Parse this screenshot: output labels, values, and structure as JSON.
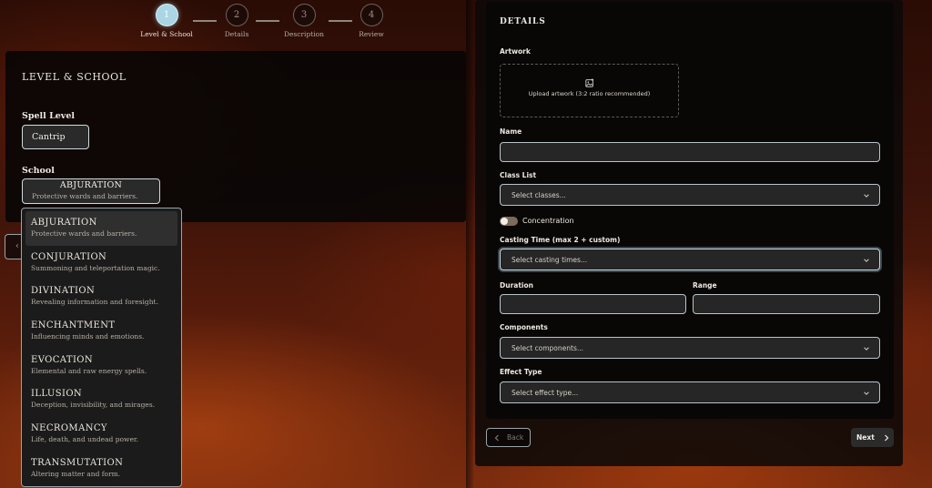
{
  "stepper": {
    "steps": [
      {
        "number": "1",
        "label": "Level & School",
        "active": true
      },
      {
        "number": "2",
        "label": "Details",
        "active": false
      },
      {
        "number": "3",
        "label": "Description",
        "active": false
      },
      {
        "number": "4",
        "label": "Review",
        "active": false
      }
    ]
  },
  "left_panel": {
    "title": "LEVEL & SCHOOL",
    "spell_level_label": "Spell Level",
    "spell_level_value": "Cantrip",
    "school_label": "School",
    "school_selected": {
      "name": "ABJURATION",
      "description": "Protective wards and barriers."
    },
    "school_options": [
      {
        "name": "ABJURATION",
        "description": "Protective wards and barriers."
      },
      {
        "name": "CONJURATION",
        "description": "Summoning and teleportation magic."
      },
      {
        "name": "DIVINATION",
        "description": "Revealing information and foresight."
      },
      {
        "name": "ENCHANTMENT",
        "description": "Influencing minds and emotions."
      },
      {
        "name": "EVOCATION",
        "description": "Elemental and raw energy spells."
      },
      {
        "name": "ILLUSION",
        "description": "Deception, invisibility, and mirages."
      },
      {
        "name": "NECROMANCY",
        "description": "Life, death, and undead power."
      },
      {
        "name": "TRANSMUTATION",
        "description": "Altering matter and form."
      }
    ]
  },
  "right_panel": {
    "title": "DETAILS",
    "artwork_label": "Artwork",
    "upload_text": "Upload artwork (3:2 ratio recommended)",
    "name_label": "Name",
    "name_value": "",
    "class_list_label": "Class List",
    "class_list_placeholder": "Select classes...",
    "concentration_label": "Concentration",
    "casting_time_label": "Casting Time (max 2 + custom)",
    "casting_time_placeholder": "Select casting times...",
    "duration_label": "Duration",
    "range_label": "Range",
    "components_label": "Components",
    "components_placeholder": "Select components...",
    "effect_type_label": "Effect Type",
    "effect_type_placeholder": "Select effect type..."
  },
  "nav": {
    "back_label": "Back",
    "next_label": "Next"
  },
  "colors": {
    "accent": "#a9d5e4",
    "panel": "#080606",
    "border": "#b9c4c8"
  }
}
